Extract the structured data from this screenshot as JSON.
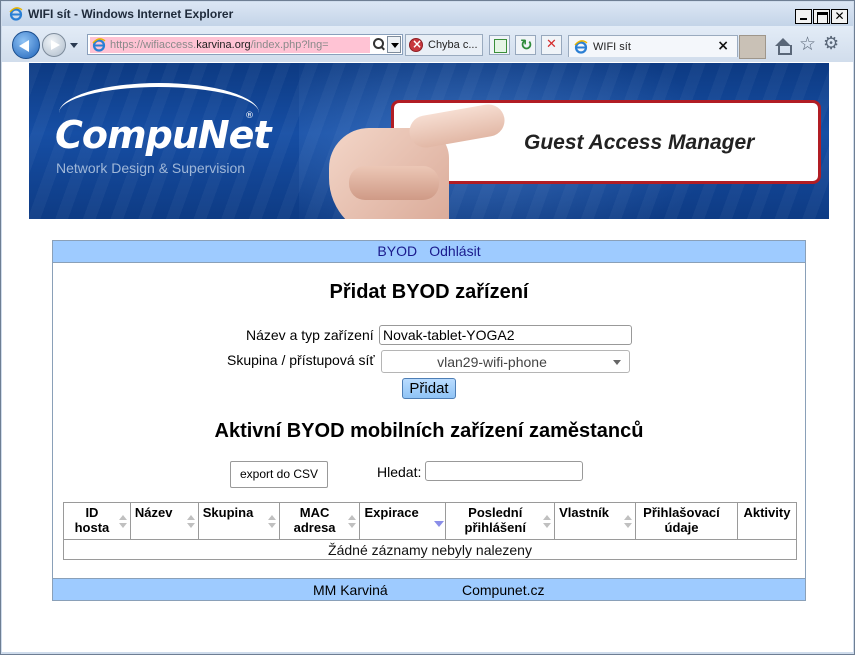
{
  "window": {
    "title": "WIFI sít - Windows Internet Explorer"
  },
  "browser": {
    "url_prefix": "https://wifiaccess.",
    "url_domain": "karvina.org",
    "url_path": "/index.php?lng=",
    "error_tab_label": "Chyba c...",
    "active_tab_label": "WIFI sít",
    "active_tab_close": "×"
  },
  "banner": {
    "brand": "CompuNet",
    "brand_reg": "®",
    "brand_sub": "Network Design & Supervision",
    "product": "Guest Access Manager"
  },
  "nav": {
    "byod": "BYOD",
    "logout": "Odhlásit"
  },
  "form": {
    "heading": "Přidat BYOD zařízení",
    "name_label": "Název a typ zařízení",
    "name_value": "Novak-tablet-YOGA2",
    "group_label": "Skupina / přístupová síť",
    "group_value": "vlan29-wifi-phone",
    "submit": "Přidat"
  },
  "list": {
    "heading": "Aktivní BYOD mobilních zařízení zaměstanců",
    "export_button": "export do CSV",
    "search_label": "Hledat:",
    "search_value": "",
    "columns": [
      "ID hosta",
      "Název",
      "Skupina",
      "MAC adresa",
      "Expirace",
      "Poslední přihlášení",
      "Vlastník",
      "Přihlašovací údaje",
      "Aktivity"
    ],
    "sorted_column": "Expirace",
    "empty_message": "Žádné záznamy nebyly nalezeny"
  },
  "footer": {
    "left": "MM Karviná",
    "right": "Compunet.cz"
  }
}
